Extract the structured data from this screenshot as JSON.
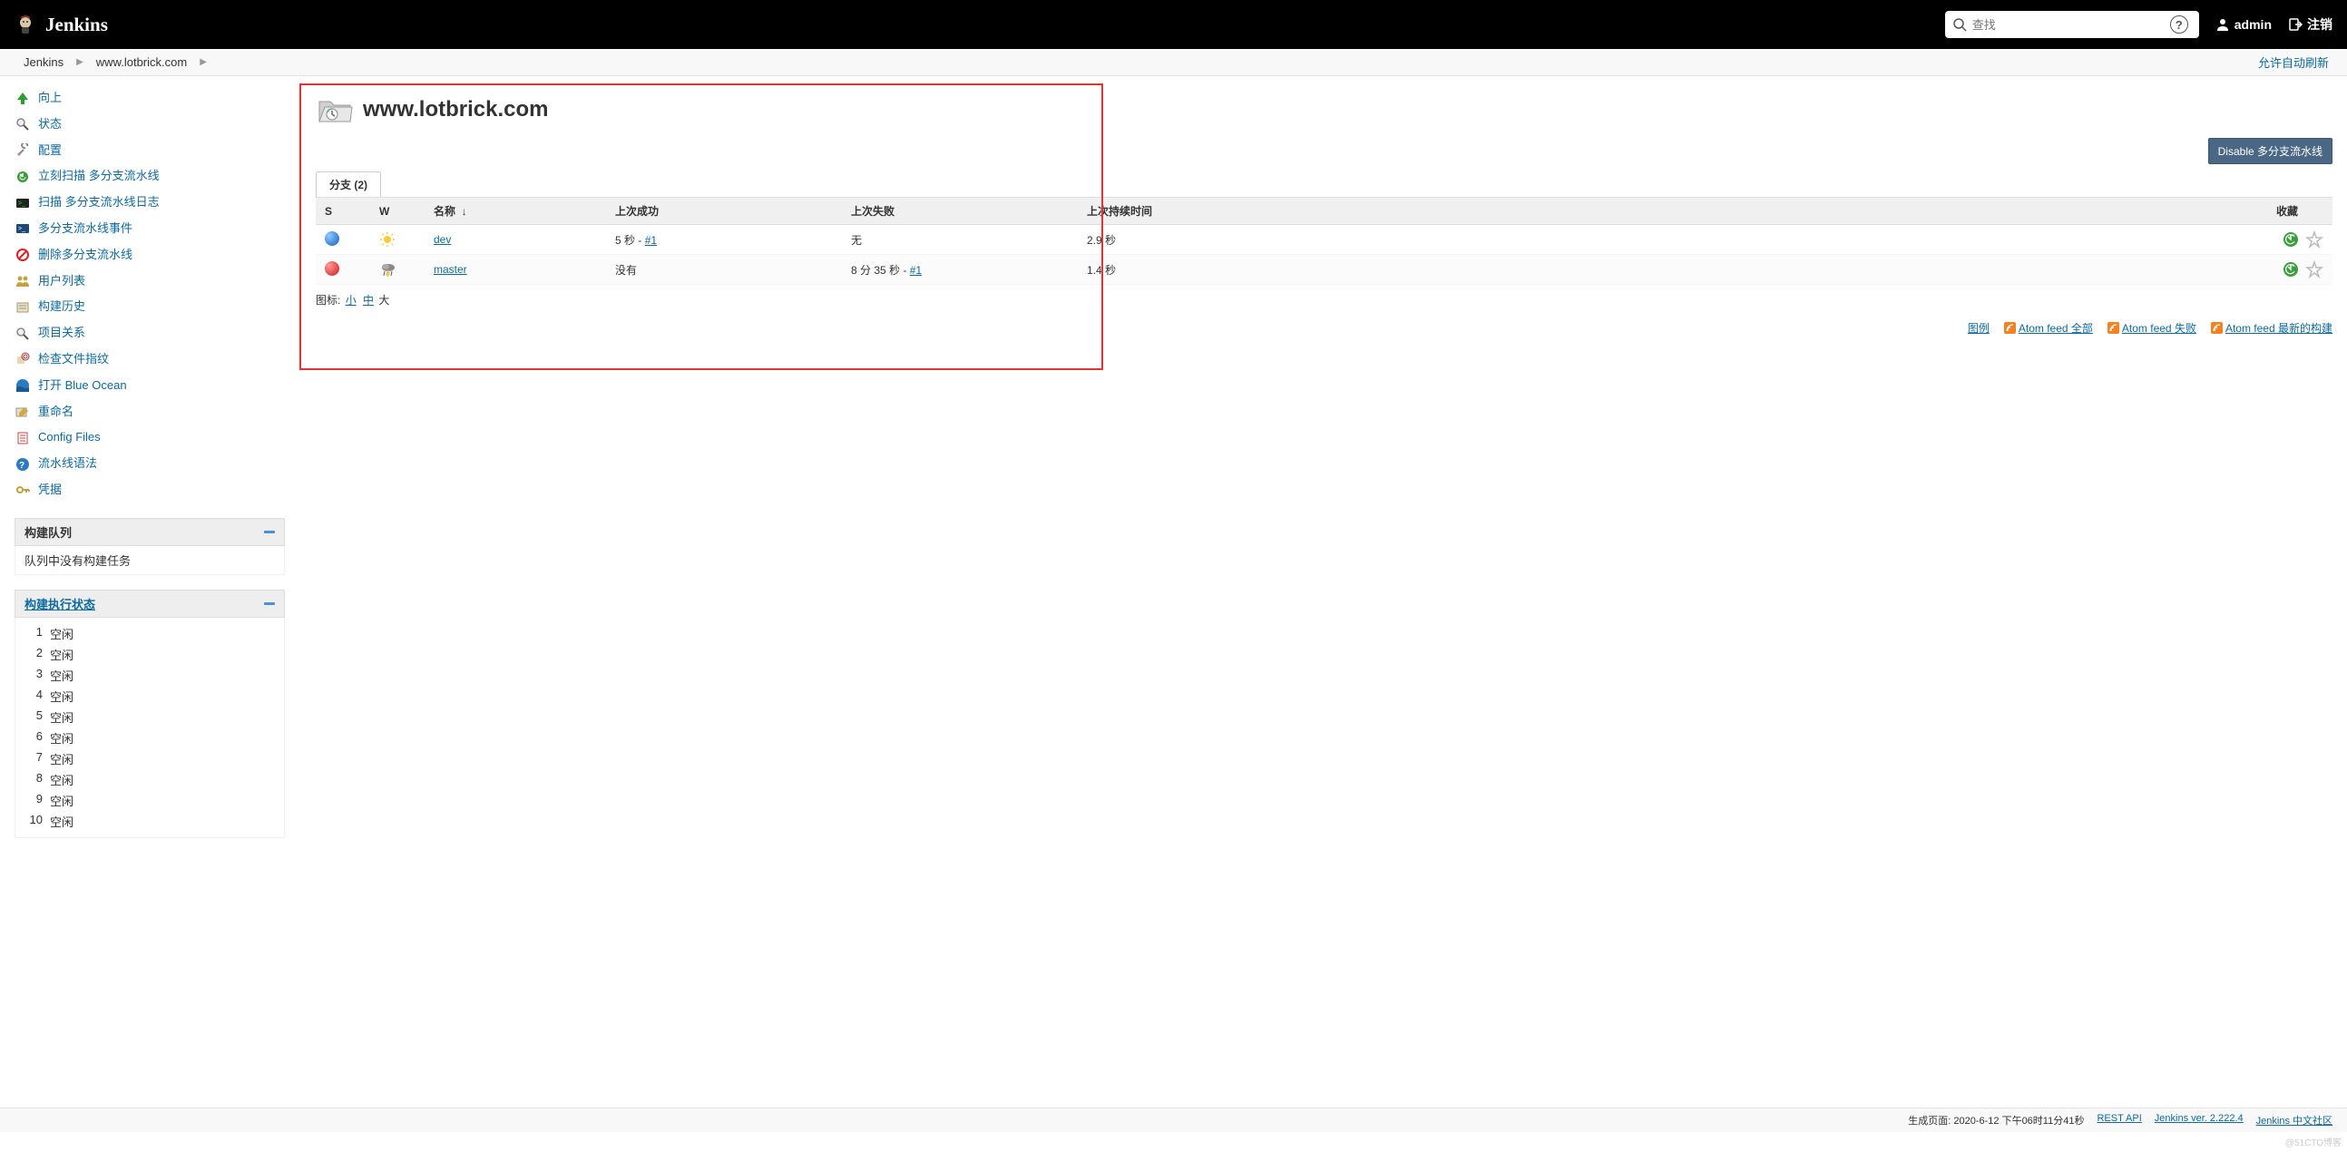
{
  "header": {
    "app_title": "Jenkins",
    "search_placeholder": "查找",
    "username": "admin",
    "logout": "注销"
  },
  "breadcrumb": {
    "items": [
      "Jenkins",
      "www.lotbrick.com"
    ],
    "auto_refresh": "允许自动刷新"
  },
  "sidebar": {
    "links": [
      {
        "label": "向上",
        "icon": "up-arrow"
      },
      {
        "label": "状态",
        "icon": "search"
      },
      {
        "label": "配置",
        "icon": "wrench"
      },
      {
        "label": "立刻扫描 多分支流水线",
        "icon": "scan"
      },
      {
        "label": "扫描 多分支流水线日志",
        "icon": "terminal"
      },
      {
        "label": "多分支流水线事件",
        "icon": "terminal2"
      },
      {
        "label": "删除多分支流水线",
        "icon": "forbid"
      },
      {
        "label": "用户列表",
        "icon": "people"
      },
      {
        "label": "构建历史",
        "icon": "history"
      },
      {
        "label": "项目关系",
        "icon": "search2"
      },
      {
        "label": "检查文件指纹",
        "icon": "fingerprint"
      },
      {
        "label": "打开 Blue Ocean",
        "icon": "blueocean"
      },
      {
        "label": "重命名",
        "icon": "rename"
      },
      {
        "label": "Config Files",
        "icon": "configfiles"
      },
      {
        "label": "流水线语法",
        "icon": "syntax"
      },
      {
        "label": "凭据",
        "icon": "key"
      }
    ],
    "build_queue": {
      "title": "构建队列",
      "empty_text": "队列中没有构建任务"
    },
    "build_exec": {
      "title": "构建执行状态",
      "executors": [
        {
          "num": "1",
          "status": "空闲"
        },
        {
          "num": "2",
          "status": "空闲"
        },
        {
          "num": "3",
          "status": "空闲"
        },
        {
          "num": "4",
          "status": "空闲"
        },
        {
          "num": "5",
          "status": "空闲"
        },
        {
          "num": "6",
          "status": "空闲"
        },
        {
          "num": "7",
          "status": "空闲"
        },
        {
          "num": "8",
          "status": "空闲"
        },
        {
          "num": "9",
          "status": "空闲"
        },
        {
          "num": "10",
          "status": "空闲"
        }
      ]
    }
  },
  "main": {
    "project_title": "www.lotbrick.com",
    "disable_btn": "Disable 多分支流水线",
    "tab_label": "分支 (2)",
    "table_headers": {
      "s": "S",
      "w": "W",
      "name": "名称",
      "sort_arrow": "↓",
      "last_success": "上次成功",
      "last_failure": "上次失败",
      "last_duration": "上次持续时间",
      "favorite": "收藏"
    },
    "rows": [
      {
        "status": "blue",
        "weather": "sunny",
        "name": "dev",
        "last_success_prefix": "5 秒 - ",
        "last_success_build": "#1",
        "last_failure": "无",
        "duration": "2.9 秒"
      },
      {
        "status": "red",
        "weather": "storm",
        "name": "master",
        "last_success_prefix": "没有",
        "last_success_build": "",
        "last_failure_prefix": "8 分 35 秒 - ",
        "last_failure_build": "#1",
        "duration": "1.4 秒"
      }
    ],
    "icon_size": {
      "label": "图标:",
      "small": "小",
      "medium": "中",
      "large": "大"
    },
    "bottom_links": {
      "legend": "图例",
      "atom_all": "Atom feed 全部",
      "atom_fail": "Atom feed 失败",
      "atom_latest": "Atom feed 最新的构建"
    }
  },
  "footer": {
    "generated": "生成页面: 2020-6-12 下午06时11分41秒",
    "rest_api": "REST API",
    "version": "Jenkins ver. 2.222.4",
    "community": "Jenkins 中文社区"
  },
  "watermark": "@51CTO博客"
}
